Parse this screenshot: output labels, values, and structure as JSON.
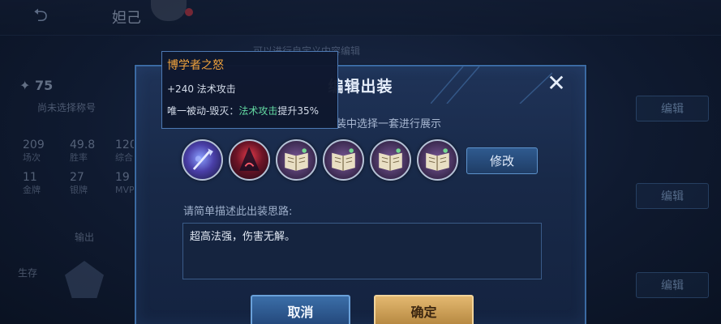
{
  "background": {
    "back_icon": "back-arrow-icon",
    "hero_name": "妲己",
    "hint_text": "，可以进行自定义内容编辑",
    "score": "75",
    "title_none": "尚未选择称号",
    "stats": [
      {
        "value": "209",
        "label": "场次"
      },
      {
        "value": "49.8",
        "label": "胜率"
      },
      {
        "value": "120",
        "label": "综合"
      },
      {
        "value": "11",
        "label": "金牌"
      },
      {
        "value": "27",
        "label": "银牌"
      },
      {
        "value": "19",
        "label": "MVP"
      }
    ],
    "output_label": "输出",
    "survive_label": "生存",
    "side_edit_labels": [
      "编辑",
      "编辑",
      "编辑"
    ]
  },
  "dialog": {
    "title": "编辑出装",
    "close_icon": "close-icon",
    "subtitle": "装中选择一套进行展示",
    "items": [
      {
        "name": "wand-item-icon",
        "type": "wand"
      },
      {
        "name": "hat-item-icon",
        "type": "hat"
      },
      {
        "name": "book-item-icon",
        "type": "book"
      },
      {
        "name": "book-item-icon",
        "type": "book"
      },
      {
        "name": "book-item-icon",
        "type": "book"
      },
      {
        "name": "book-item-icon",
        "type": "book"
      }
    ],
    "modify_label": "修改",
    "desc_label": "请简单描述此出装思路:",
    "desc_value": "超高法强，伤害无解。",
    "cancel_label": "取消",
    "ok_label": "确定"
  },
  "tooltip": {
    "title": "博学者之怒",
    "line1": "+240 法术攻击",
    "line2_prefix": "唯一被动-毁灭：",
    "line2_highlight": "法术攻击",
    "line2_suffix": "提升35%"
  },
  "colors": {
    "accent_blue": "#3b6aa3",
    "tooltip_title": "#f0a23c",
    "highlight_green": "#62d8a1",
    "confirm_gold": "#e3b870"
  }
}
